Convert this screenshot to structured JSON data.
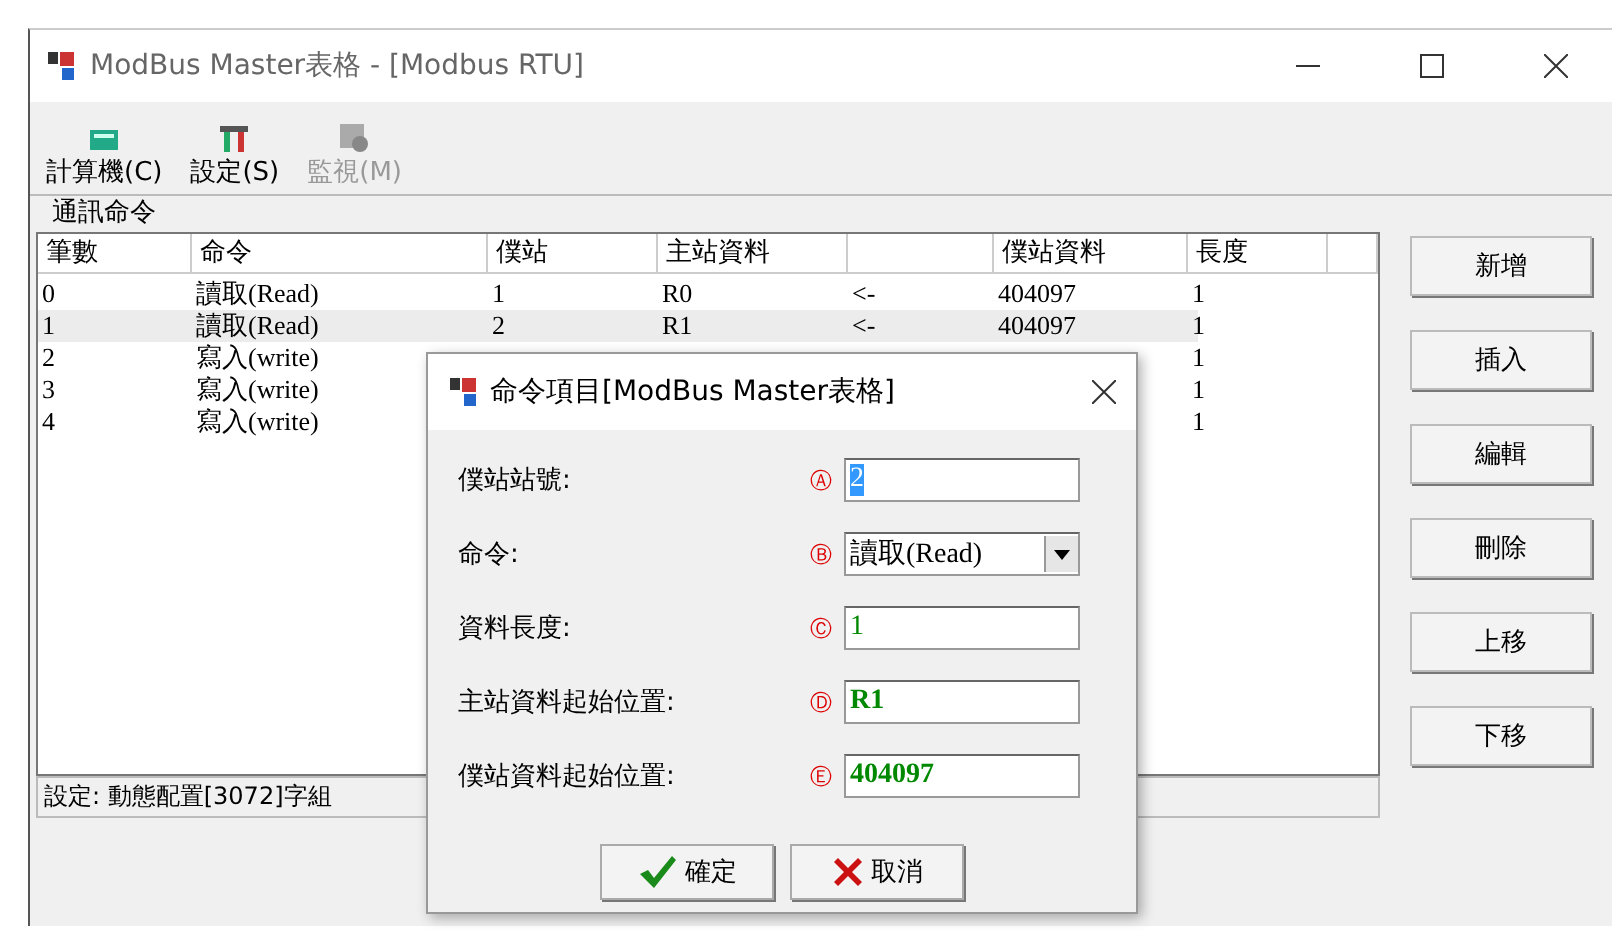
{
  "window": {
    "title": "ModBus Master表格 - [Modbus RTU]"
  },
  "toolbar": [
    {
      "label": "計算機(C)",
      "kind": "calculator",
      "disabled": false
    },
    {
      "label": "設定(S)",
      "kind": "tools",
      "disabled": false
    },
    {
      "label": "監視(M)",
      "kind": "monitor",
      "disabled": true
    }
  ],
  "group": {
    "title": "通訊命令"
  },
  "table": {
    "columns": [
      {
        "kind": "label",
        "label": "筆數"
      },
      {
        "kind": "label",
        "label": "命令"
      },
      {
        "kind": "label",
        "label": "僕站"
      },
      {
        "kind": "label",
        "label": "主站資料"
      },
      {
        "kind": "blank"
      },
      {
        "kind": "label",
        "label": "僕站資料"
      },
      {
        "kind": "label",
        "label": "長度"
      },
      {
        "kind": "blank"
      }
    ],
    "rows": [
      {
        "index": "0",
        "command": "讀取(Read)",
        "slave": "1",
        "master_data": "R0",
        "column_5": "<-",
        "slave_data": "404097",
        "length": "1",
        "selected": false
      },
      {
        "index": "1",
        "command": "讀取(Read)",
        "slave": "2",
        "master_data": "R1",
        "column_5": "<-",
        "slave_data": "404097",
        "length": "1",
        "selected": true
      },
      {
        "index": "2",
        "command": "寫入(write)",
        "length": "1",
        "selected": false
      },
      {
        "index": "3",
        "command": "寫入(write)",
        "length": "1",
        "selected": false
      },
      {
        "index": "4",
        "command": "寫入(write)",
        "length": "1",
        "selected": false
      }
    ]
  },
  "status_bar": "設定: 動態配置[3072]字組",
  "side_buttons": [
    "新增",
    "插入",
    "編輯",
    "刪除",
    "上移",
    "下移"
  ],
  "dialog": {
    "title": "命令項目[ModBus Master表格]",
    "fields": [
      {
        "label": "僕站站號:",
        "marker": "Ⓐ",
        "kind": "text",
        "value": "2",
        "highlighted": true,
        "bold": false
      },
      {
        "label": "命令:",
        "marker": "Ⓑ",
        "kind": "dropdown",
        "value": "讀取(Read)",
        "highlighted": false,
        "bold": false
      },
      {
        "label": "資料長度:",
        "marker": "Ⓒ",
        "kind": "text",
        "value": "1",
        "highlighted": false,
        "bold": false
      },
      {
        "label": "主站資料起始位置:",
        "marker": "Ⓓ",
        "kind": "text",
        "value": "R1",
        "highlighted": false,
        "bold": true
      },
      {
        "label": "僕站資料起始位置:",
        "marker": "Ⓔ",
        "kind": "text",
        "value": "404097",
        "highlighted": false,
        "bold": true
      }
    ],
    "buttons": [
      {
        "label": "確定",
        "kind": "ok"
      },
      {
        "label": "取消",
        "kind": "cancel"
      }
    ]
  }
}
